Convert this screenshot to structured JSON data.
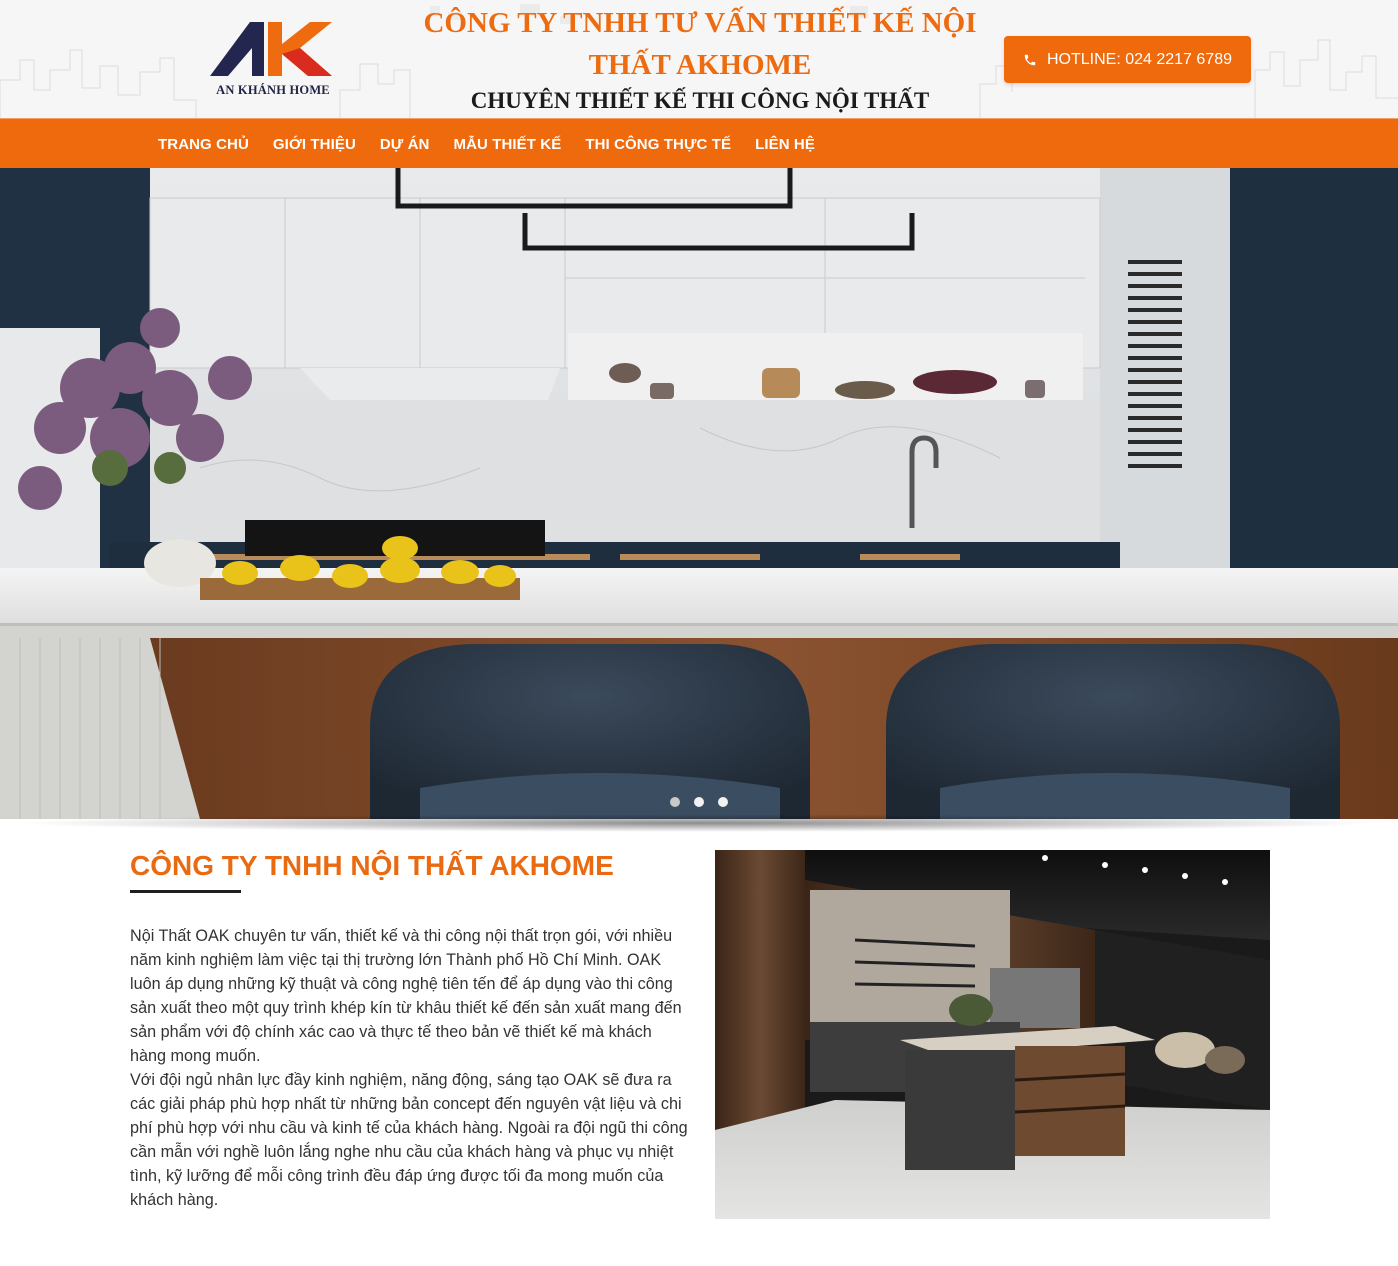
{
  "header": {
    "logo_text": "AN KHÁNH HOME",
    "company_title": "CÔNG TY TNHH TƯ VẤN THIẾT KẾ NỘI THẤT AKHOME",
    "slogan": "CHUYÊN THIẾT KẾ THI CÔNG NỘI THẤT",
    "hotline_label": "HOTLINE: 024 2217 6789",
    "hotline_icon": "phone-icon",
    "logo_colors": {
      "navy": "#23264f",
      "orange": "#ee6b10",
      "red": "#d92b1e"
    }
  },
  "nav": {
    "items": [
      {
        "label": "TRANG CHỦ"
      },
      {
        "label": "GIỚI THIỆU"
      },
      {
        "label": "DỰ ÁN"
      },
      {
        "label": "MẪU THIẾT KẾ"
      },
      {
        "label": "THI CÔNG THỰC TẾ"
      },
      {
        "label": "LIÊN HỆ"
      }
    ]
  },
  "hero": {
    "image": "kitchen-interior-slide",
    "slides_count": 3,
    "active_slide": 2
  },
  "about": {
    "title": "CÔNG TY TNHH NỘI THẤT AKHOME",
    "paragraph_1": "Nội Thất OAK chuyên tư vấn, thiết kế và thi công nội thất trọn gói, với nhiều năm kinh nghiệm làm việc tại thị trường lớn Thành phố Hồ Chí Minh. OAK luôn áp dụng những kỹ thuật và công nghệ tiên tến để áp dụng vào thi công sản xuất theo một quy trình khép kín từ khâu thiết kế đến sản xuất mang đến sản phẩm với độ chính xác cao và thực tế theo bản vẽ thiết kế mà khách hàng mong muốn.",
    "paragraph_2": "Với đội ngủ nhân lực đầy kinh nghiệm, năng động, sáng tạo OAK sẽ đưa ra các giải pháp phù hợp nhất từ những bản concept đến nguyên vật liệu và chi phí phù hợp với nhu cầu và kinh tế của khách hàng. Ngoài ra đội ngũ thi công cần mẫn với nghề luôn lắng nghe nhu cầu của khách hàng và phục vụ nhiệt tình, kỹ lưỡng để mỗi công trình đều đáp ứng được tối đa mong muốn của khách hàng.",
    "image": "modern-kitchen-showroom"
  },
  "theme": {
    "accent": "#ee6a0c",
    "title_orange": "#ea6a12"
  }
}
